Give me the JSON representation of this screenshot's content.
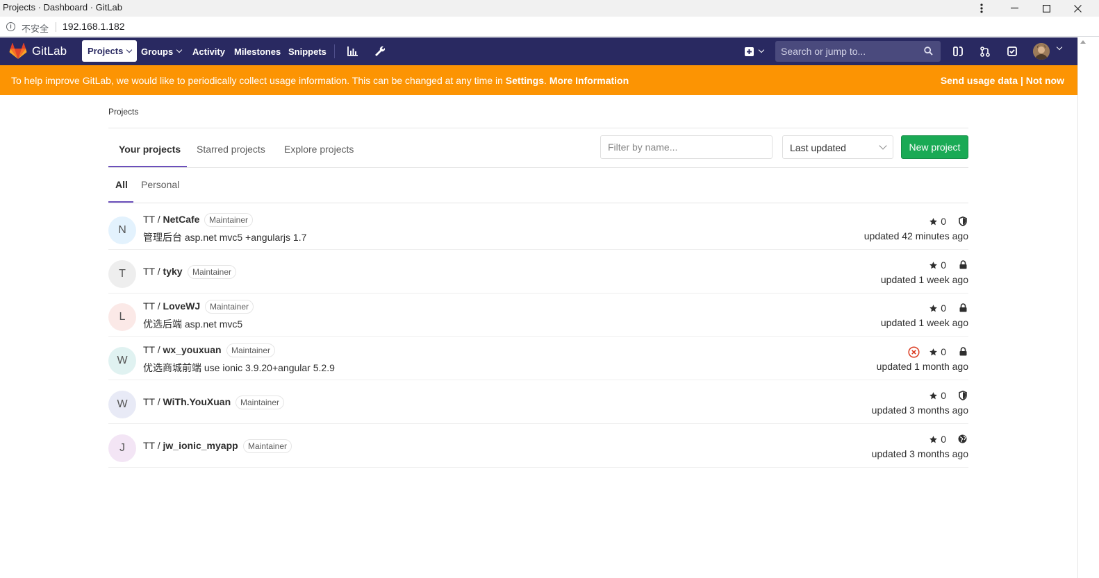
{
  "browser": {
    "window_title": "Projects · Dashboard · GitLab",
    "security_label": "不安全",
    "url": "192.168.1.182"
  },
  "header": {
    "brand": "GitLab",
    "nav": {
      "projects": "Projects",
      "groups": "Groups",
      "activity": "Activity",
      "milestones": "Milestones",
      "snippets": "Snippets"
    },
    "search_placeholder": "Search or jump to..."
  },
  "banner": {
    "message": "To help improve GitLab, we would like to periodically collect usage information. This can be changed at any time in",
    "settings_link": "Settings",
    "more_link": "More Information",
    "send_label": "Send usage data",
    "separator": "|",
    "dismiss_label": "Not now"
  },
  "breadcrumb": "Projects",
  "tabs": {
    "your_projects": "Your projects",
    "starred_projects": "Starred projects",
    "explore_projects": "Explore projects"
  },
  "filter": {
    "placeholder": "Filter by name...",
    "sort_selected": "Last updated",
    "new_project_label": "New project"
  },
  "subtabs": {
    "all": "All",
    "personal": "Personal"
  },
  "projects": [
    {
      "initial": "N",
      "namespace": "TT / ",
      "name": "NetCafe",
      "role": "Maintainer",
      "description": "管理后台 asp.net mvc5 +angularjs 1.7",
      "stars": "0",
      "visibility": "internal",
      "updated": "updated 42 minutes ago",
      "avatar_color": "#e3f2fd"
    },
    {
      "initial": "T",
      "namespace": "TT / ",
      "name": "tyky",
      "role": "Maintainer",
      "description": "",
      "stars": "0",
      "visibility": "private",
      "updated": "updated 1 week ago",
      "avatar_color": "#eeeeee"
    },
    {
      "initial": "L",
      "namespace": "TT / ",
      "name": "LoveWJ",
      "role": "Maintainer",
      "description": "优选后端 asp.net mvc5",
      "stars": "0",
      "visibility": "private",
      "updated": "updated 1 week ago",
      "avatar_color": "#fbe9e7"
    },
    {
      "initial": "W",
      "namespace": "TT / ",
      "name": "wx_youxuan",
      "role": "Maintainer",
      "description": "优选商城前端 use ionic 3.9.20+angular 5.2.9",
      "stars": "0",
      "visibility": "private",
      "pipeline": "failed",
      "updated": "updated 1 month ago",
      "avatar_color": "#e0f2f1"
    },
    {
      "initial": "W",
      "namespace": "TT / ",
      "name": "WiTh.YouXuan",
      "role": "Maintainer",
      "description": "",
      "stars": "0",
      "visibility": "internal",
      "updated": "updated 3 months ago",
      "avatar_color": "#e8eaf6"
    },
    {
      "initial": "J",
      "namespace": "TT / ",
      "name": "jw_ionic_myapp",
      "role": "Maintainer",
      "description": "",
      "stars": "0",
      "visibility": "public",
      "updated": "updated 3 months ago",
      "avatar_color": "#f3e5f5"
    }
  ],
  "colors": {
    "header_bg": "#292961",
    "banner_bg": "#fc9403",
    "accent": "#6b4fbb",
    "primary_button": "#1aaa55",
    "pipeline_failed": "#db3b21"
  }
}
